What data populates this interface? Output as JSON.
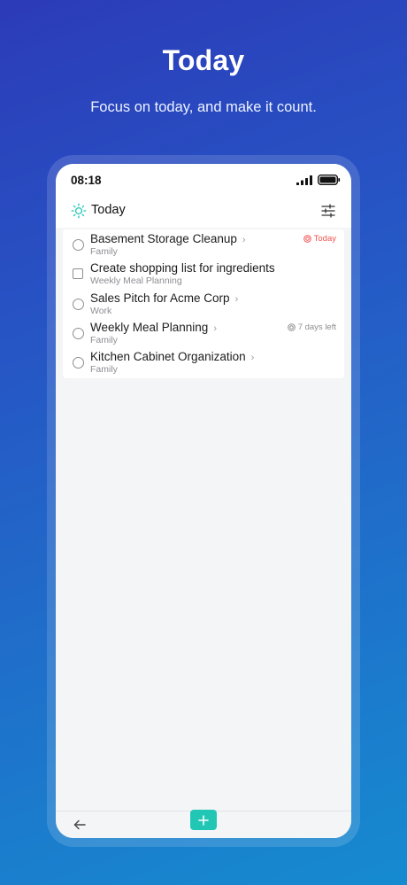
{
  "hero": {
    "title": "Today",
    "subtitle": "Focus on today, and make it count."
  },
  "status_bar": {
    "time": "08:18",
    "icons": [
      "signal-icon",
      "battery-icon"
    ]
  },
  "header": {
    "title": "Today",
    "icon": "sun-icon",
    "filter_icon": "sliders-icon"
  },
  "tasks": [
    {
      "title": "Basement Storage Cleanup",
      "subtitle": "Family",
      "control": "circle",
      "has_chevron": true,
      "due": "Today",
      "due_color": "#ef5350",
      "due_icon": "target-icon"
    },
    {
      "title": "Create shopping list for ingredients",
      "subtitle": "Weekly Meal Planning",
      "control": "square",
      "has_chevron": false,
      "due": "",
      "due_color": "",
      "due_icon": ""
    },
    {
      "title": "Sales Pitch for Acme Corp",
      "subtitle": "Work",
      "control": "circle",
      "has_chevron": true,
      "due": "",
      "due_color": "",
      "due_icon": ""
    },
    {
      "title": "Weekly Meal Planning",
      "subtitle": "Family",
      "control": "circle",
      "has_chevron": true,
      "due": "7 days left",
      "due_color": "#8e8e93",
      "due_icon": "target-icon"
    },
    {
      "title": "Kitchen Cabinet Organization",
      "subtitle": "Family",
      "control": "circle",
      "has_chevron": true,
      "due": "",
      "due_color": "",
      "due_icon": ""
    }
  ],
  "bottom_bar": {
    "back_icon": "arrow-left-icon",
    "add_icon": "plus-icon",
    "add_color": "#21c6b5"
  },
  "colors": {
    "background_top": "#2c3bb8",
    "background_bottom": "#168bd0",
    "accent": "#21c6b5",
    "overdue": "#ef5350"
  }
}
